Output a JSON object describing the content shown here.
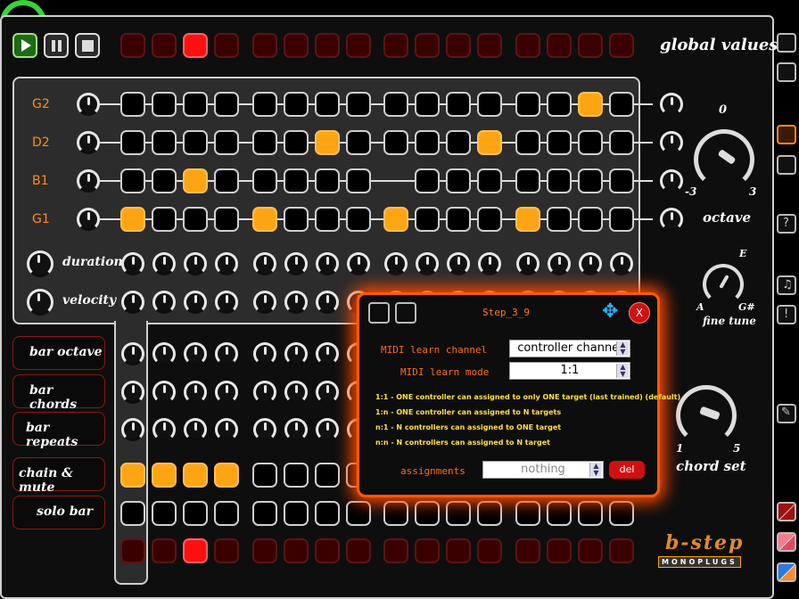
{
  "transport": {
    "play": "play",
    "pause": "pause",
    "stop": "stop"
  },
  "global_title": "global values",
  "tracks": [
    {
      "note": "G2",
      "on": [
        14
      ]
    },
    {
      "note": "D2",
      "on": [
        6,
        11
      ]
    },
    {
      "note": "B1",
      "on": [
        2
      ]
    },
    {
      "note": "G1",
      "on": [
        0,
        4,
        8,
        12
      ]
    }
  ],
  "playhead_value": "0",
  "knob_rows": {
    "duration": "duration",
    "velocity": "velocity"
  },
  "bar_rows": {
    "bar_octave": "bar octave",
    "bar_chords": "bar chords",
    "bar_repeats": "bar repeats",
    "chain_mute": "chain & mute",
    "solo_bar": "solo bar"
  },
  "chain_on": [
    0,
    1,
    2,
    3
  ],
  "right_panel": {
    "octave": {
      "value": "0",
      "min": "-3",
      "max": "3",
      "label": "octave"
    },
    "fine_tune": {
      "top": "E",
      "left": "A",
      "right": "G#",
      "label": "fine tune"
    },
    "chord_set": {
      "min": "1",
      "max": "5",
      "label": "chord set"
    }
  },
  "dialog": {
    "title": "Step_3_9",
    "close": "X",
    "channel_label": "MIDI learn channel",
    "channel_value": "controller channel",
    "mode_label": "MIDI learn mode",
    "mode_value": "1:1",
    "notes": [
      "1:1 - ONE controller can assigned to only ONE target (last trained) (default)",
      "1:n - ONE controller can assigned to N targets",
      "n:1 - N controllers can assigned to ONE target",
      "n:n - N controllers can assigned to N target"
    ],
    "assign_label": "assignments",
    "assign_value": "nothing",
    "del": "del"
  },
  "logo": {
    "text": "b-step",
    "sub": "MONOPLUGS"
  },
  "colors": {
    "accent": "#ffa514",
    "red": "#ff1010",
    "dialog_border": "#ff5a00"
  }
}
